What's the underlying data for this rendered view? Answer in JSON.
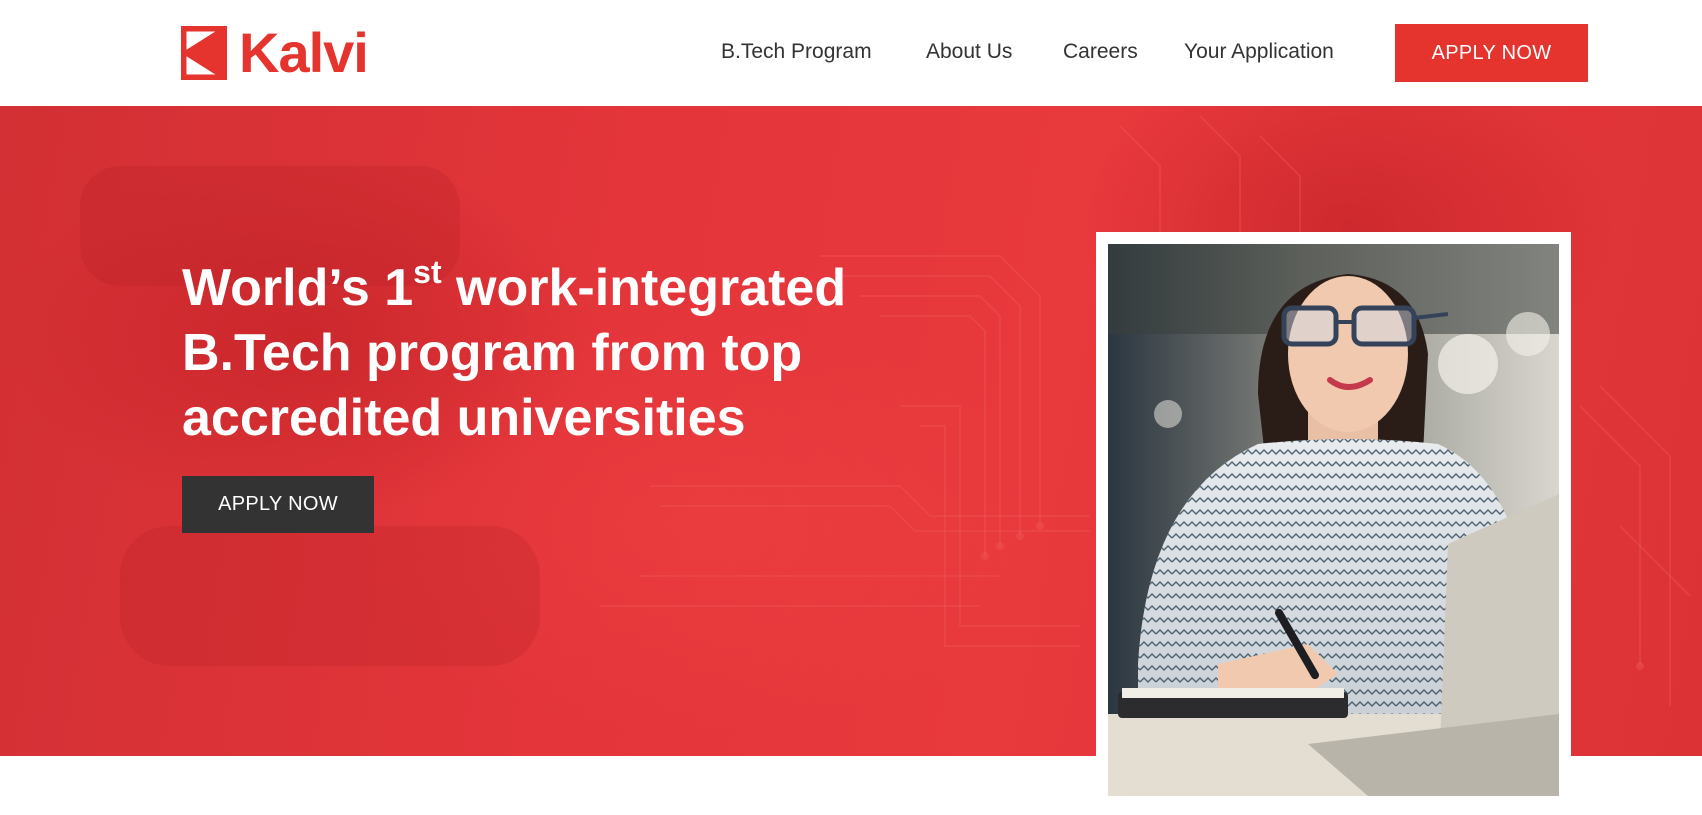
{
  "brand": {
    "name": "Kalvi",
    "accent_color": "#e5332e",
    "dark_color": "#333333",
    "logo_icon": "kalvi-logo-mark"
  },
  "nav": {
    "items": [
      {
        "label": "B.Tech Program"
      },
      {
        "label": "About Us"
      },
      {
        "label": "Careers"
      },
      {
        "label": "Your Application"
      }
    ],
    "cta_label": "APPLY NOW"
  },
  "hero": {
    "headline_part1": "World’s 1",
    "headline_sup": "st",
    "headline_part2": " work-integrated B.Tech program from top accredited universities",
    "cta_label": "APPLY NOW",
    "image_icon": "student-at-laptop-photo"
  }
}
